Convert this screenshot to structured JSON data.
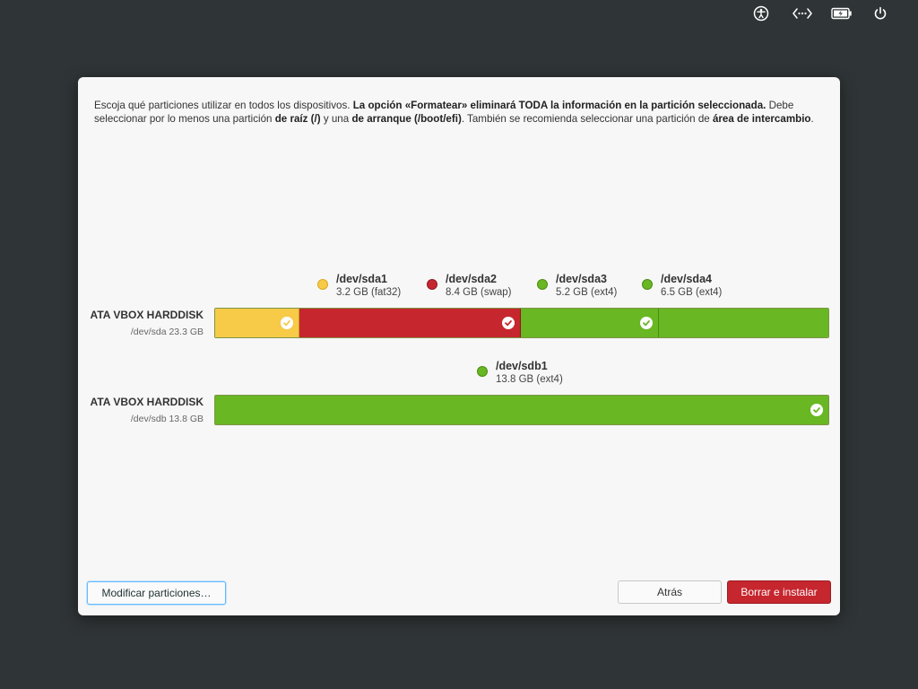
{
  "intro": {
    "p1": "Escoja qué particiones utilizar en todos los dispositivos. ",
    "p1_bold": "La opción «Formatear» eliminará TODA la información en la partición seleccionada.",
    "p2": " Debe seleccionar por lo menos una partición ",
    "p2_bold1": "de raíz (/)",
    "p3": " y una ",
    "p3_bold": "de arranque (/boot/efi)",
    "p4": ". También se recomienda seleccionar una partición de ",
    "p4_bold": "área de intercambio",
    "p5": "."
  },
  "colors": {
    "yellow": "#f7ca48",
    "red": "#c6262e",
    "green": "#68b723",
    "accent": "#64baff"
  },
  "disks": [
    {
      "name": "ATA VBOX HARDDISK",
      "sub": "/dev/sda 23.3 GB",
      "partitions": [
        {
          "name": "/dev/sda1",
          "size": "3.2 GB (fat32)",
          "color": "yellow",
          "gb": 3.2,
          "checked": true
        },
        {
          "name": "/dev/sda2",
          "size": "8.4 GB (swap)",
          "color": "red",
          "gb": 8.4,
          "checked": true
        },
        {
          "name": "/dev/sda3",
          "size": "5.2 GB (ext4)",
          "color": "green",
          "gb": 5.2,
          "checked": true
        },
        {
          "name": "/dev/sda4",
          "size": "6.5 GB (ext4)",
          "color": "green",
          "gb": 6.5,
          "checked": false
        }
      ]
    },
    {
      "name": "ATA VBOX HARDDISK",
      "sub": "/dev/sdb 13.8 GB",
      "partitions": [
        {
          "name": "/dev/sdb1",
          "size": "13.8 GB (ext4)",
          "color": "green",
          "gb": 13.8,
          "checked": true
        }
      ]
    }
  ],
  "buttons": {
    "modify": "Modificar particiones…",
    "back": "Atrás",
    "install": "Borrar e instalar"
  },
  "topbar_icons": [
    "accessibility-icon",
    "network-icon",
    "battery-charging-icon",
    "power-icon"
  ]
}
